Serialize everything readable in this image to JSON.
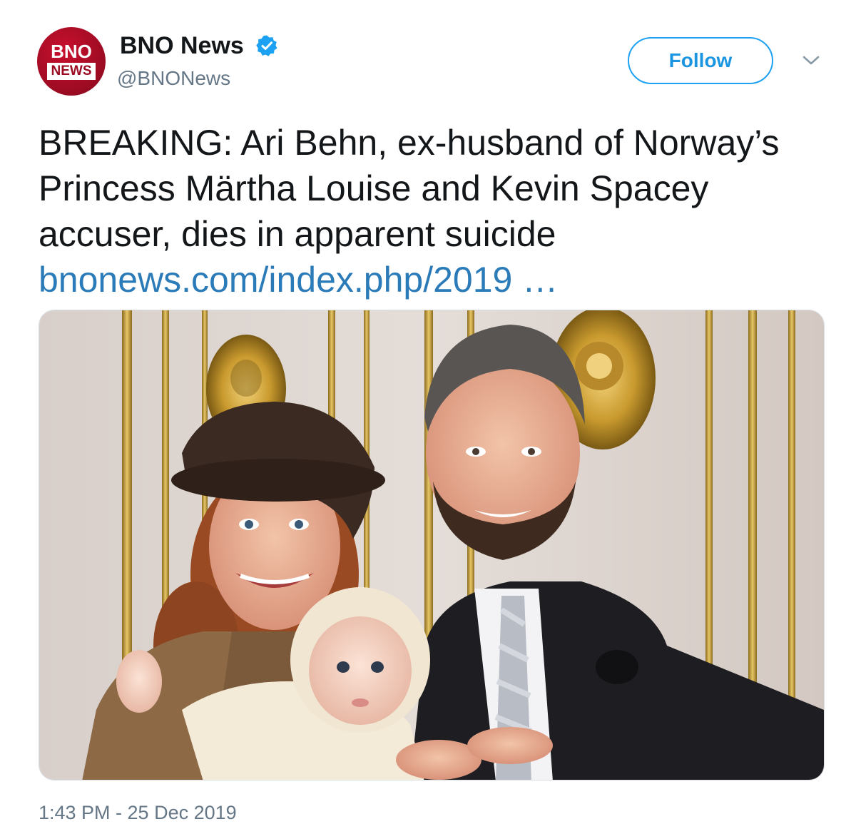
{
  "author": {
    "avatar_top": "BNO",
    "avatar_bottom": "NEWS",
    "display_name": "BNO News",
    "handle": "@BNONews",
    "verified": true
  },
  "actions": {
    "follow_label": "Follow",
    "menu_icon": "chevron-down-icon"
  },
  "tweet": {
    "text": "BREAKING: Ari Behn, ex-husband of Norway’s Princess Märtha Louise and Kevin Spacey accuser, dies in apparent suicide",
    "link_text": "bnonews.com/index.php/2019 …",
    "timestamp": "1:43 PM - 25 Dec 2019"
  },
  "colors": {
    "brand_red": "#c8102e",
    "accent_blue": "#1da1f2",
    "link_blue": "#2b7bb9",
    "muted_gray": "#657786"
  }
}
